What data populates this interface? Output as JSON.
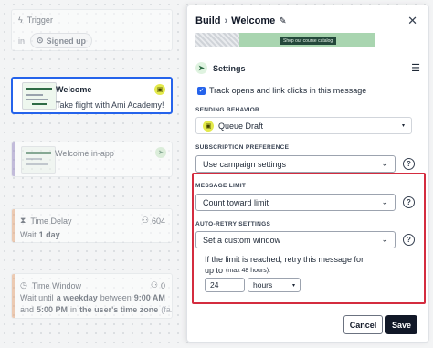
{
  "workflow": {
    "trigger": {
      "label": "Trigger",
      "in_label": "in",
      "chip": "Signed up"
    },
    "welcome": {
      "title": "Welcome",
      "subtitle": "Take flight with Ami Academy!"
    },
    "welcome_inapp": {
      "title": "Welcome in-app"
    },
    "delay": {
      "title": "Time Delay",
      "count": "604",
      "wait_prefix": "Wait",
      "wait_value": "1 day"
    },
    "window": {
      "title": "Time Window",
      "count": "0",
      "line1_a": "Wait until",
      "line1_b": "a weekday",
      "line1_c": "between",
      "line1_d": "9:00 AM",
      "line2_a": "and",
      "line2_b": "5:00 PM",
      "line2_c": "in",
      "line2_d": "the user's time zone",
      "line2_e": "(fa..."
    }
  },
  "panel": {
    "breadcrumb_root": "Build",
    "breadcrumb_sep": "›",
    "title": "Welcome",
    "close": "✕",
    "banner_cta": "Shop our course catalog",
    "settings_label": "Settings",
    "track_label": "Track opens and link clicks in this message",
    "sending_behavior": {
      "label": "SENDING BEHAVIOR",
      "value": "Queue Draft"
    },
    "subscription": {
      "label": "SUBSCRIPTION PREFERENCE",
      "value": "Use campaign settings"
    },
    "message_limit": {
      "label": "MESSAGE LIMIT",
      "value": "Count toward limit"
    },
    "auto_retry": {
      "label": "AUTO-RETRY SETTINGS",
      "value": "Set a custom window",
      "desc_line1": "If the limit is reached, retry this message for",
      "desc_line2_a": "up to",
      "desc_line2_b": "(max 48 hours):",
      "amount": "24",
      "unit": "hours"
    },
    "help": "?",
    "cancel": "Cancel",
    "save": "Save"
  },
  "colors": {
    "accent_blue": "#2563eb",
    "highlight_red": "#d42c3f",
    "delay_orange": "#e8a87c",
    "inapp_purple": "#9b8ec4",
    "save_dark": "#111827"
  }
}
